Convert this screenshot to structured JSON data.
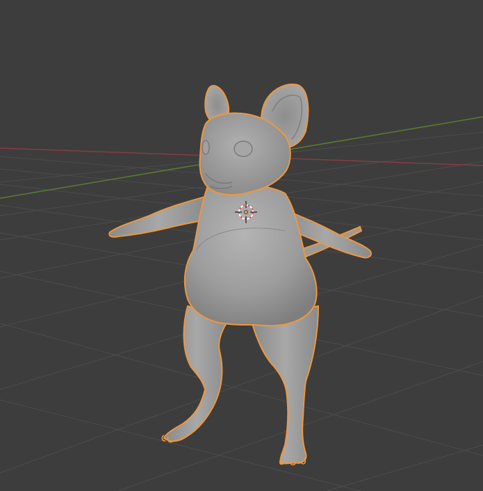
{
  "viewport": {
    "mode": "object-mode",
    "shading": "solid",
    "background_color": "#3d3d3d",
    "grid_color": "#4a4a4a",
    "x_axis_color": "#8a3a44",
    "y_axis_color": "#5c7d2e",
    "selection_outline_color": "#f0973c",
    "mesh_color": "#9a9a9a"
  },
  "scene": {
    "selected_object": {
      "kind": "mesh",
      "depicts": "mouse-character",
      "selected": true
    },
    "cursor_3d": {
      "visible": true
    }
  }
}
